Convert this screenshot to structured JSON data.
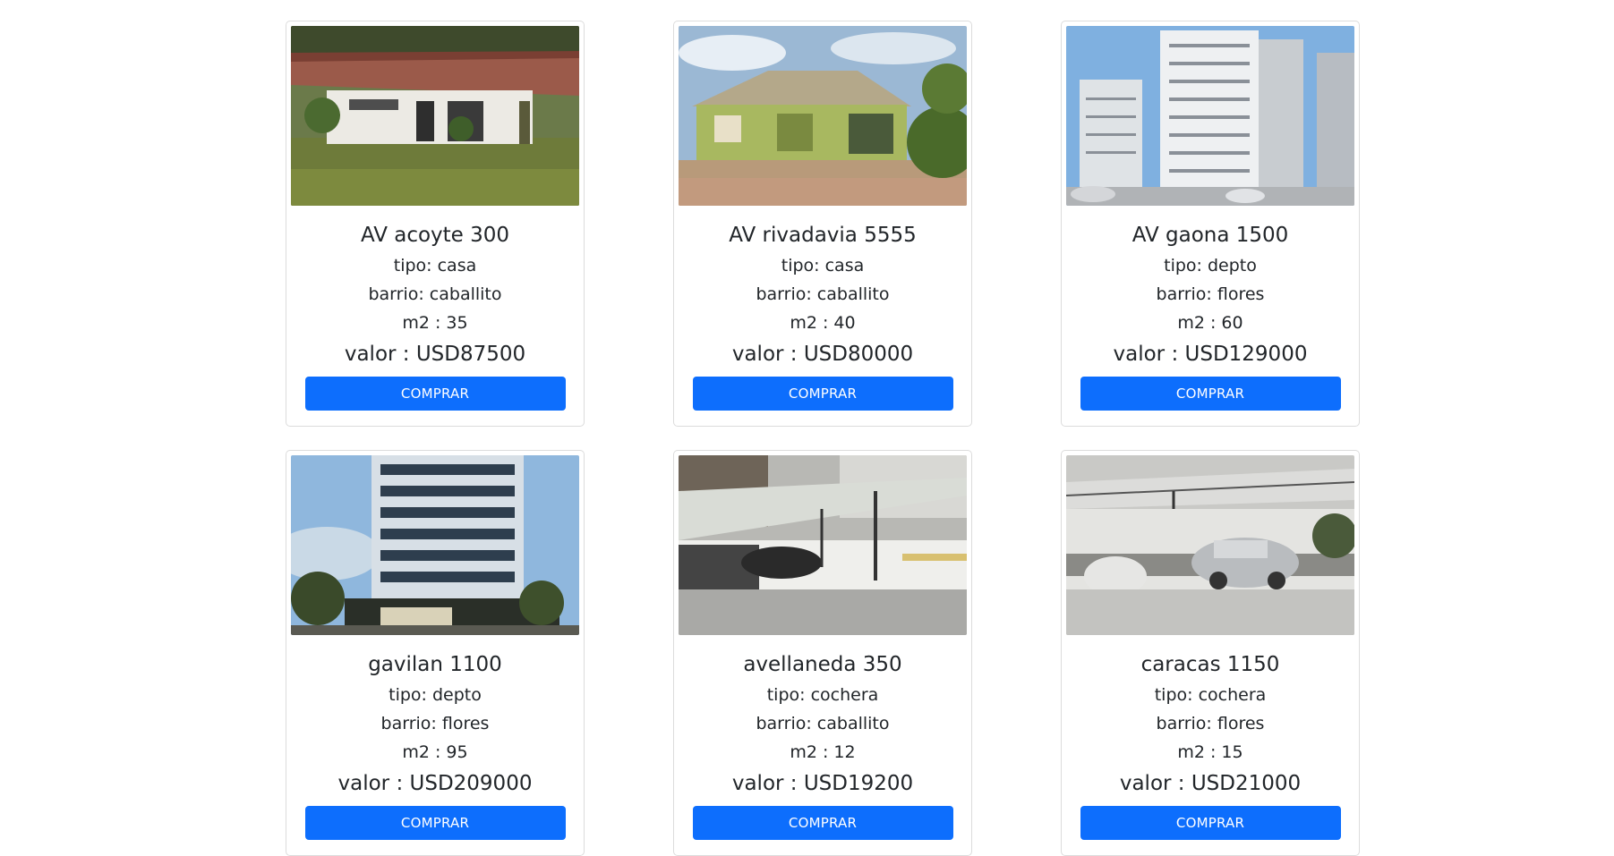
{
  "accent_color": "#0d6efd",
  "cards": [
    {
      "title": "AV acoyte 300",
      "tipo": "tipo: casa",
      "barrio": "barrio: caballito",
      "m2": "m2 : 35",
      "valor": "valor : USD87500",
      "button": "COMPRAR",
      "image": "house-photo"
    },
    {
      "title": "AV rivadavia 5555",
      "tipo": "tipo: casa",
      "barrio": "barrio: caballito",
      "m2": "m2 : 40",
      "valor": "valor : USD80000",
      "button": "COMPRAR",
      "image": "house-photo"
    },
    {
      "title": "AV gaona 1500",
      "tipo": "tipo: depto",
      "barrio": "barrio: flores",
      "m2": "m2 : 60",
      "valor": "valor : USD129000",
      "button": "COMPRAR",
      "image": "apartment-building-photo"
    },
    {
      "title": "gavilan 1100",
      "tipo": "tipo: depto",
      "barrio": "barrio: flores",
      "m2": "m2 : 95",
      "valor": "valor : USD209000",
      "button": "COMPRAR",
      "image": "apartment-building-photo"
    },
    {
      "title": "avellaneda 350",
      "tipo": "tipo: cochera",
      "barrio": "barrio: caballito",
      "m2": "m2 : 12",
      "valor": "valor : USD19200",
      "button": "COMPRAR",
      "image": "garage-photo"
    },
    {
      "title": "caracas 1150",
      "tipo": "tipo: cochera",
      "barrio": "barrio: flores",
      "m2": "m2 : 15",
      "valor": "valor : USD21000",
      "button": "COMPRAR",
      "image": "garage-photo"
    }
  ]
}
